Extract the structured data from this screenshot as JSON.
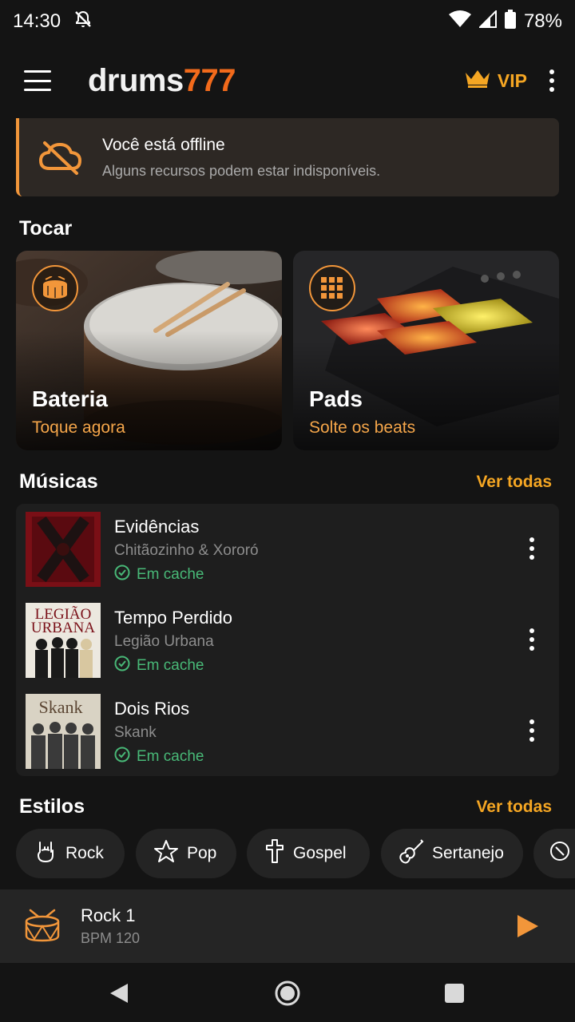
{
  "status_bar": {
    "time": "14:30",
    "battery": "78%"
  },
  "app_bar": {
    "logo_text": "drums",
    "logo_number": "777",
    "vip_label": "VIP"
  },
  "offline_banner": {
    "title": "Você está offline",
    "subtitle": "Alguns recursos podem estar indisponíveis."
  },
  "play_section": {
    "title": "Tocar",
    "cards": [
      {
        "title": "Bateria",
        "subtitle": "Toque agora",
        "icon": "snare-drum-icon"
      },
      {
        "title": "Pads",
        "subtitle": "Solte os beats",
        "icon": "grid-pads-icon"
      }
    ]
  },
  "songs_section": {
    "title": "Músicas",
    "see_all": "Ver todas",
    "items": [
      {
        "title": "Evidências",
        "artist": "Chitãozinho & Xororó",
        "status": "Em cache",
        "cover_text": ""
      },
      {
        "title": "Tempo Perdido",
        "artist": "Legião Urbana",
        "status": "Em cache",
        "cover_text": "LEGIÃO URBANA"
      },
      {
        "title": "Dois Rios",
        "artist": "Skank",
        "status": "Em cache",
        "cover_text": "Skank"
      }
    ]
  },
  "styles_section": {
    "title": "Estilos",
    "see_all": "Ver todas",
    "chips": [
      {
        "label": "Rock",
        "icon": "rock-hand-icon"
      },
      {
        "label": "Pop",
        "icon": "star-icon"
      },
      {
        "label": "Gospel",
        "icon": "cross-icon"
      },
      {
        "label": "Sertanejo",
        "icon": "guitar-icon"
      }
    ]
  },
  "mini_player": {
    "title": "Rock 1",
    "bpm": "BPM 120"
  },
  "colors": {
    "accent": "#f26a1b",
    "gold": "#f5a623",
    "success": "#48b877",
    "background": "#141414"
  }
}
